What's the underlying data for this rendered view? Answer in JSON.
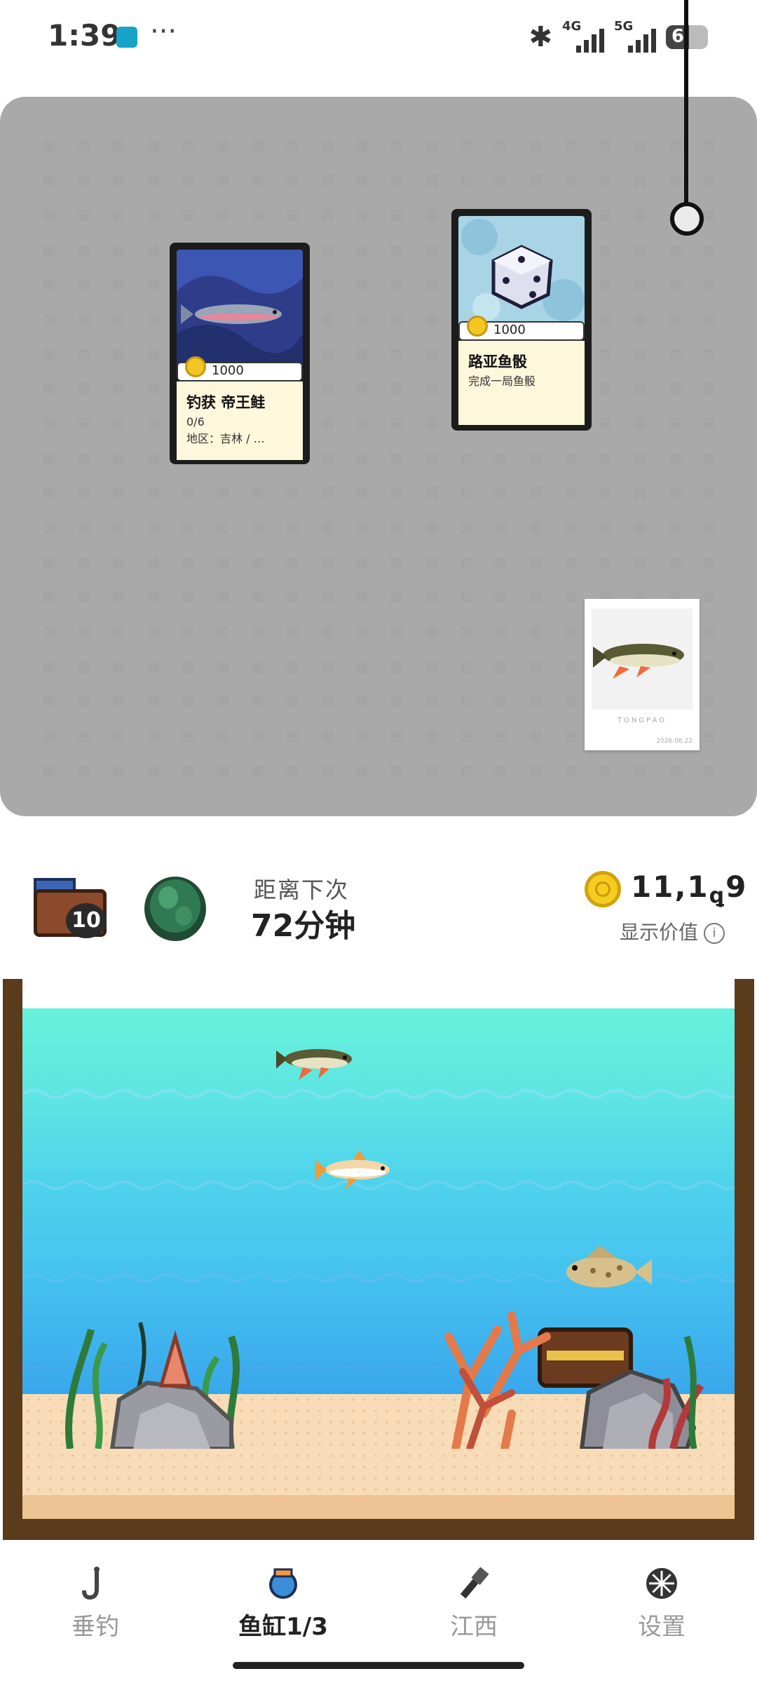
{
  "status_bar": {
    "time": "1:39",
    "network_1": "4G",
    "network_2": "5G",
    "battery": "6"
  },
  "cards": [
    {
      "price": "1000",
      "title": "钓获 帝王鲑",
      "progress": "0/6",
      "region": "地区：吉林 / …"
    },
    {
      "price": "1000",
      "title": "路亚鱼骰",
      "desc": "完成一局鱼骰"
    }
  ],
  "photo": {
    "brand": "TONGPAO",
    "date": "2026.06.22"
  },
  "info_row": {
    "chest_count": "10",
    "next_label": "距离下次",
    "next_value": "72分钟",
    "balance": "11,1",
    "balance_tail": "9",
    "show_value_label": "显示价值"
  },
  "nav": {
    "items": [
      {
        "label": "垂钓"
      },
      {
        "label": "鱼缸1/3"
      },
      {
        "label": "江西"
      },
      {
        "label": "设置"
      }
    ],
    "active_index": 1
  },
  "colors": {
    "accent_gold": "#f5cd1f",
    "tank_frame": "#5a3b1c",
    "water_top": "#66f2dc",
    "water_bottom": "#2f95e6"
  },
  "icons": [
    "bluetooth-icon",
    "signal-icon",
    "battery-icon",
    "coin-icon",
    "info-icon",
    "hook-icon",
    "fish-tank-icon",
    "flashlight-icon",
    "settings-icon"
  ]
}
